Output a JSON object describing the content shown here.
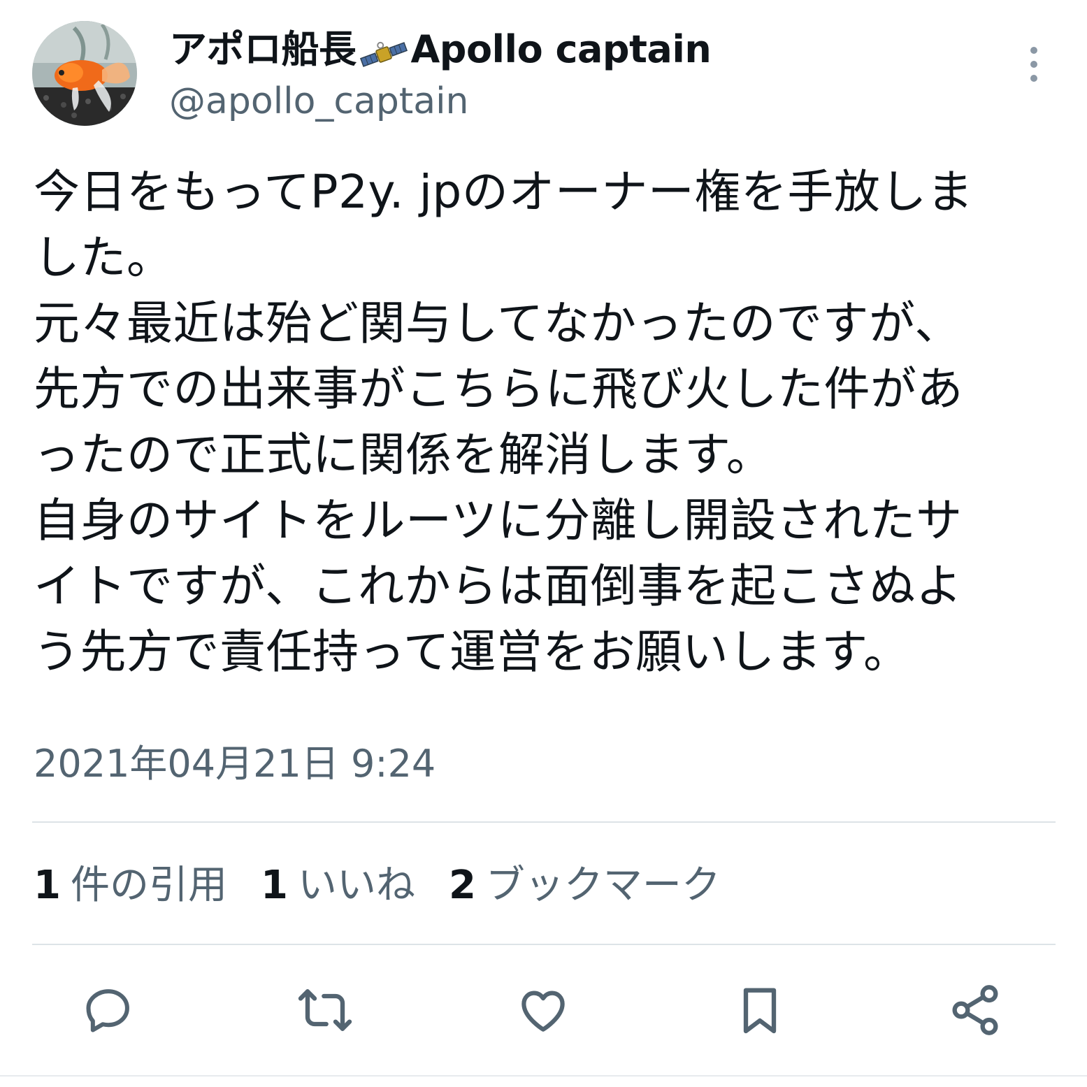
{
  "user": {
    "display_name_jp": "アポロ船長",
    "display_name_icon": "satellite-icon",
    "display_name_en": "Apollo captain",
    "handle": "@apollo_captain"
  },
  "tweet": {
    "text": "今日をもってP2y. jpのオーナー権を手放しま\nした。\n元々最近は殆ど関与してなかったのですが、\n先方での出来事がこちらに飛び火した件があ\nったので正式に関係を解消します。\n自身のサイトをルーツに分離し開設されたサ\nイトですが、これからは面倒事を起こさぬよ\nう先方で責任持って運営をお願いします。",
    "timestamp": "2021年04月21日 9:24"
  },
  "stats": [
    {
      "count": "1",
      "label": "件の引用"
    },
    {
      "count": "1",
      "label": "いいね"
    },
    {
      "count": "2",
      "label": "ブックマーク"
    }
  ],
  "actions": [
    {
      "name": "reply",
      "icon": "reply-icon"
    },
    {
      "name": "retweet",
      "icon": "retweet-icon"
    },
    {
      "name": "like",
      "icon": "heart-icon"
    },
    {
      "name": "bookmark",
      "icon": "bookmark-icon"
    },
    {
      "name": "share",
      "icon": "share-icon"
    }
  ],
  "colors": {
    "text": "#0f1419",
    "secondary": "#536471",
    "divider": "#dde3e7",
    "icon": "#536471"
  }
}
